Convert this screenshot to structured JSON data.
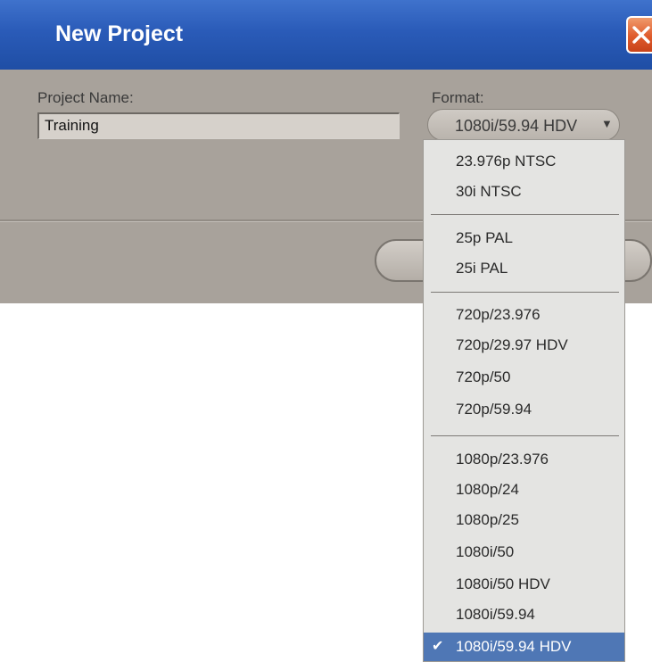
{
  "dialog": {
    "title": "New Project",
    "project_name_label": "Project Name:",
    "project_name_value": "Training",
    "format_label": "Format:",
    "format_value": "1080i/59.94 HDV"
  },
  "format_menu": {
    "groups": [
      [
        "23.976p NTSC",
        "30i NTSC"
      ],
      [
        "25p PAL",
        "25i PAL"
      ],
      [
        "720p/23.976",
        "720p/29.97 HDV",
        "720p/50",
        "720p/59.94"
      ],
      [
        "1080p/23.976",
        "1080p/24",
        "1080p/25",
        "1080i/50",
        "1080i/50 HDV",
        "1080i/59.94",
        "1080i/59.94 HDV"
      ]
    ],
    "selected": "1080i/59.94 HDV"
  },
  "colors": {
    "title_bar": "#2a5bb8",
    "dialog_bg": "#a8a29b",
    "menu_bg": "#e4e4e2",
    "selection": "#4f77b5",
    "close_button": "#df5b2c"
  },
  "icons": {
    "close": "close-icon",
    "dropdown": "chevron-down-icon",
    "selected_marker": "checkmark-icon"
  }
}
